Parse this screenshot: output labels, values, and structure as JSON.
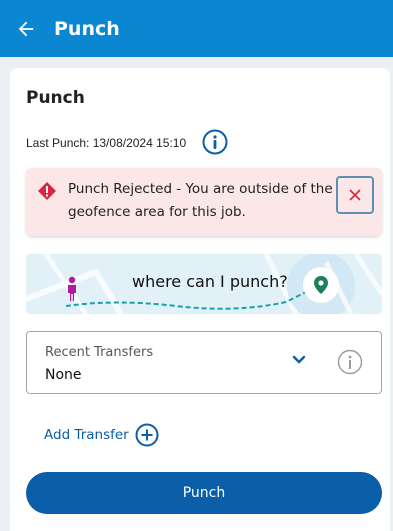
{
  "header": {
    "title": "Punch",
    "back_icon": "back-arrow-icon"
  },
  "card": {
    "title": "Punch",
    "last_punch": "Last Punch: 13/08/2024 15:10"
  },
  "alert": {
    "message": "Punch Rejected - You are outside of the geofence area for this job.",
    "icon": "warning-diamond-icon",
    "close_icon": "close-icon"
  },
  "geofence": {
    "label": "where can I punch?"
  },
  "recent_transfers": {
    "label": "Recent Transfers",
    "value": "None"
  },
  "add_transfer": {
    "label": "Add Transfer"
  },
  "punch_button": {
    "label": "Punch"
  },
  "colors": {
    "app_bar": "#0b86d1",
    "primary": "#0b5ea8",
    "alert_bg": "#fbe7e7",
    "alert_icon": "#d7263d",
    "map_pin": "#1e7f5c",
    "person": "#b5179e"
  }
}
